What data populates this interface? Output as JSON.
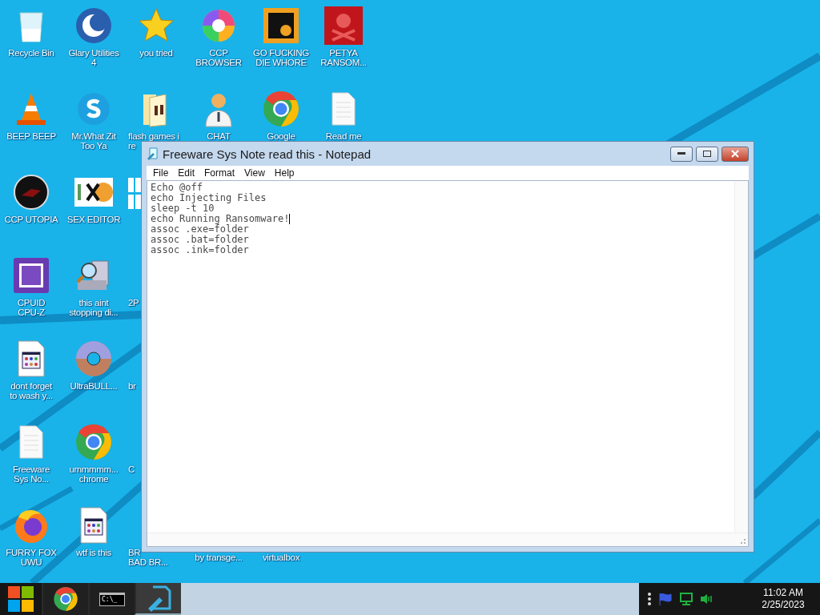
{
  "desktop_icons": [
    [
      {
        "kind": "recyclebin",
        "label": "Recycle Bin"
      },
      {
        "kind": "glary",
        "label": "Glary Utilities\n4"
      },
      {
        "kind": "star",
        "label": "you tried"
      },
      {
        "kind": "swirl",
        "label": "CCP\nBROWSER"
      },
      {
        "kind": "de",
        "label": "GO FUCKING\nDIE WHORE"
      },
      {
        "kind": "skull",
        "label": "PETYA\nRANSOM..."
      }
    ],
    [
      {
        "kind": "cone",
        "label": "BEEP BEEP"
      },
      {
        "kind": "skype",
        "label": "Mr.What Zit\nToo Ya"
      },
      {
        "kind": "folder",
        "cut_right": true,
        "label": "flash games i\nre"
      },
      {
        "kind": "doctor",
        "label": "CHAT"
      },
      {
        "kind": "chrome",
        "label": "Google"
      },
      {
        "kind": "document",
        "label": "Read me"
      }
    ],
    [
      {
        "kind": "reddisc",
        "label": "CCP UTOPIA"
      },
      {
        "kind": "hxd",
        "label": "SEX EDITOR"
      },
      {
        "kind": "windows",
        "cut_right": true
      }
    ],
    [
      {
        "kind": "cpuz",
        "label": "CPUID\nCPU-Z"
      },
      {
        "kind": "scanner",
        "label": "this aint\nstopping di..."
      },
      {
        "cut_right": true,
        "label": "2P"
      }
    ],
    [
      {
        "kind": "appfile",
        "label": "dont forget\nto wash y..."
      },
      {
        "kind": "disc",
        "label": "UltraBULL..."
      },
      {
        "cut_right": true,
        "label": "br"
      }
    ],
    [
      {
        "kind": "document",
        "label": "Freeware\nSys No..."
      },
      {
        "kind": "chrome",
        "label": "ummmmm...\nchrome"
      },
      {
        "cut_right": true,
        "label": "C"
      }
    ],
    [
      {
        "kind": "firefox",
        "label": "FURRY FOX\nUWU"
      },
      {
        "kind": "appfile",
        "label": "wtf is this"
      },
      {
        "cut_right": true,
        "label": "BR\nBAD BR..."
      },
      {
        "cut_top": true,
        "label": "by transge..."
      },
      {
        "cut_top": true,
        "label": "virtualbox"
      }
    ]
  ],
  "notepad": {
    "title": "Freeware Sys Note read this - Notepad",
    "menu": [
      "File",
      "Edit",
      "Format",
      "View",
      "Help"
    ],
    "lines": [
      {
        "text": "Echo @off",
        "caret": false
      },
      {
        "text": "echo Injecting Files",
        "caret": false
      },
      {
        "text": "sleep -t 10",
        "caret": false
      },
      {
        "text": "echo Running Ransomware!",
        "caret": true
      },
      {
        "text": "assoc .exe=folder",
        "caret": false
      },
      {
        "text": "assoc .bat=folder",
        "caret": false
      },
      {
        "text": "assoc .ink=folder",
        "caret": false
      }
    ]
  },
  "taskbar": {
    "apps": [
      {
        "kind": "chrome",
        "selected": false
      },
      {
        "kind": "terminal",
        "selected": false,
        "text": "C:\\_"
      },
      {
        "kind": "notepad",
        "selected": true
      }
    ],
    "clock": {
      "time": "11:02 AM",
      "date": "2/25/2023"
    }
  }
}
